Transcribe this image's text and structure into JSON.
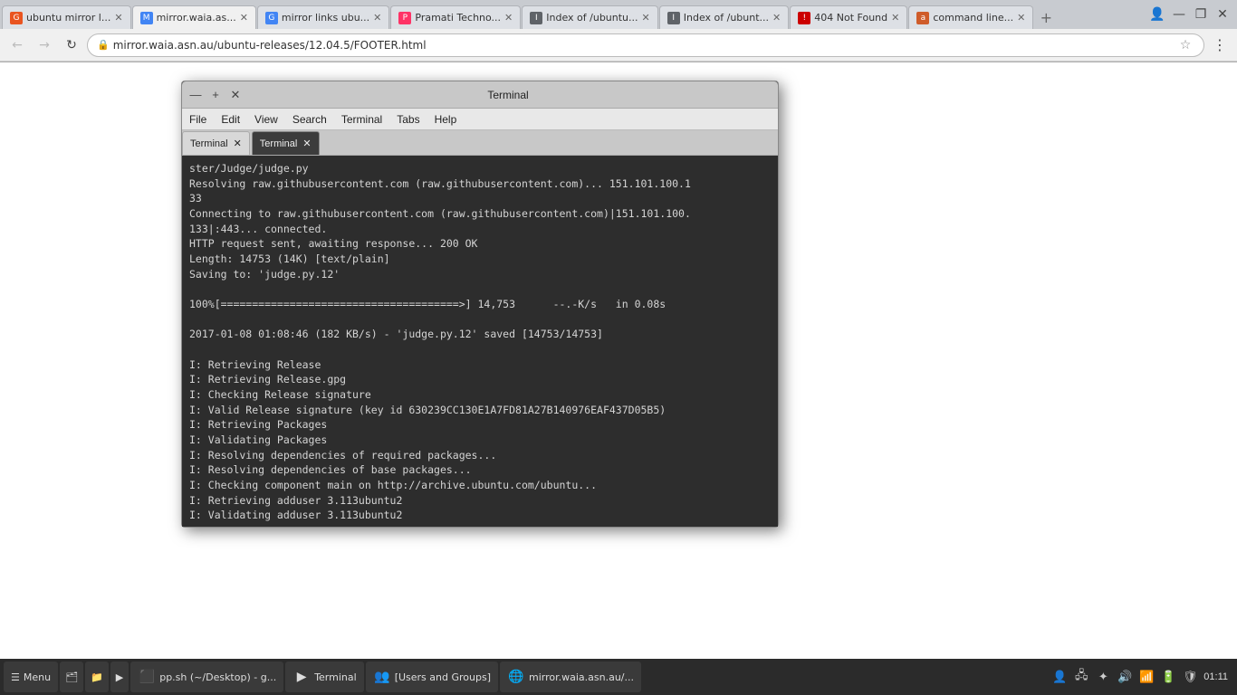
{
  "browser": {
    "tabs": [
      {
        "id": 1,
        "label": "ubuntu mirror l...",
        "favicon_type": "ubuntu",
        "favicon_text": "G",
        "active": false
      },
      {
        "id": 2,
        "label": "mirror.waia.as...",
        "favicon_type": "chrome",
        "favicon_text": "M",
        "active": true
      },
      {
        "id": 3,
        "label": "mirror links ubu...",
        "favicon_type": "chrome",
        "favicon_text": "G",
        "active": false
      },
      {
        "id": 4,
        "label": "Pramati Techno...",
        "favicon_type": "invision",
        "favicon_text": "P",
        "active": false
      },
      {
        "id": 5,
        "label": "Index of /ubuntu...",
        "favicon_type": "generic",
        "favicon_text": "I",
        "active": false
      },
      {
        "id": 6,
        "label": "Index of /ubunt...",
        "favicon_type": "generic",
        "favicon_text": "I",
        "active": false
      },
      {
        "id": 7,
        "label": "404 Not Found",
        "favicon_type": "404",
        "favicon_text": "!",
        "active": false
      },
      {
        "id": 8,
        "label": "command line...",
        "favicon_type": "ask",
        "favicon_text": "a",
        "active": false
      }
    ],
    "address": "mirror.waia.asn.au/ubuntu-releases/12.04.5/FOOTER.html",
    "address_full": "http://mirror.waia.asn.au/ubuntu-releases/12.04.5/FOOTER.html"
  },
  "terminal": {
    "title": "Terminal",
    "menubar": [
      "File",
      "Edit",
      "View",
      "Search",
      "Terminal",
      "Tabs",
      "Help"
    ],
    "tabs": [
      {
        "label": "Terminal",
        "active": false
      },
      {
        "label": "Terminal",
        "active": true
      }
    ],
    "output_lines": [
      "ster/Judge/judge.py",
      "Resolving raw.githubusercontent.com (raw.githubusercontent.com)... 151.101.100.1",
      "33",
      "Connecting to raw.githubusercontent.com (raw.githubusercontent.com)|151.101.100.",
      "133|:443... connected.",
      "HTTP request sent, awaiting response... 200 OK",
      "Length: 14753 (14K) [text/plain]",
      "Saving to: 'judge.py.12'",
      "",
      "100%[======================================>] 14,753      --.-K/s   in 0.08s",
      "",
      "2017-01-08 01:08:46 (182 KB/s) - 'judge.py.12' saved [14753/14753]",
      "",
      "I: Retrieving Release",
      "I: Retrieving Release.gpg",
      "I: Checking Release signature",
      "I: Valid Release signature (key id 630239CC130E1A7FD81A27B140976EAF437D05B5)",
      "I: Retrieving Packages",
      "I: Validating Packages",
      "I: Resolving dependencies of required packages...",
      "I: Resolving dependencies of base packages...",
      "I: Checking component main on http://archive.ubuntu.com/ubuntu...",
      "I: Retrieving adduser 3.113ubuntu2",
      "I: Validating adduser 3.113ubuntu2"
    ]
  },
  "taskbar": {
    "menu_label": "Menu",
    "items": [
      {
        "label": "pp.sh (~/Desktop) - g...",
        "icon": "⬛"
      },
      {
        "label": "Terminal",
        "icon": "▶"
      },
      {
        "label": "[Users and Groups]",
        "icon": "👥"
      },
      {
        "label": "mirror.waia.asn.au/...",
        "icon": "🌐"
      }
    ],
    "tray": {
      "time": "01:11",
      "icons": [
        "👤",
        "🖧",
        "🔊",
        "📶",
        "🔋",
        "🛡"
      ]
    }
  }
}
